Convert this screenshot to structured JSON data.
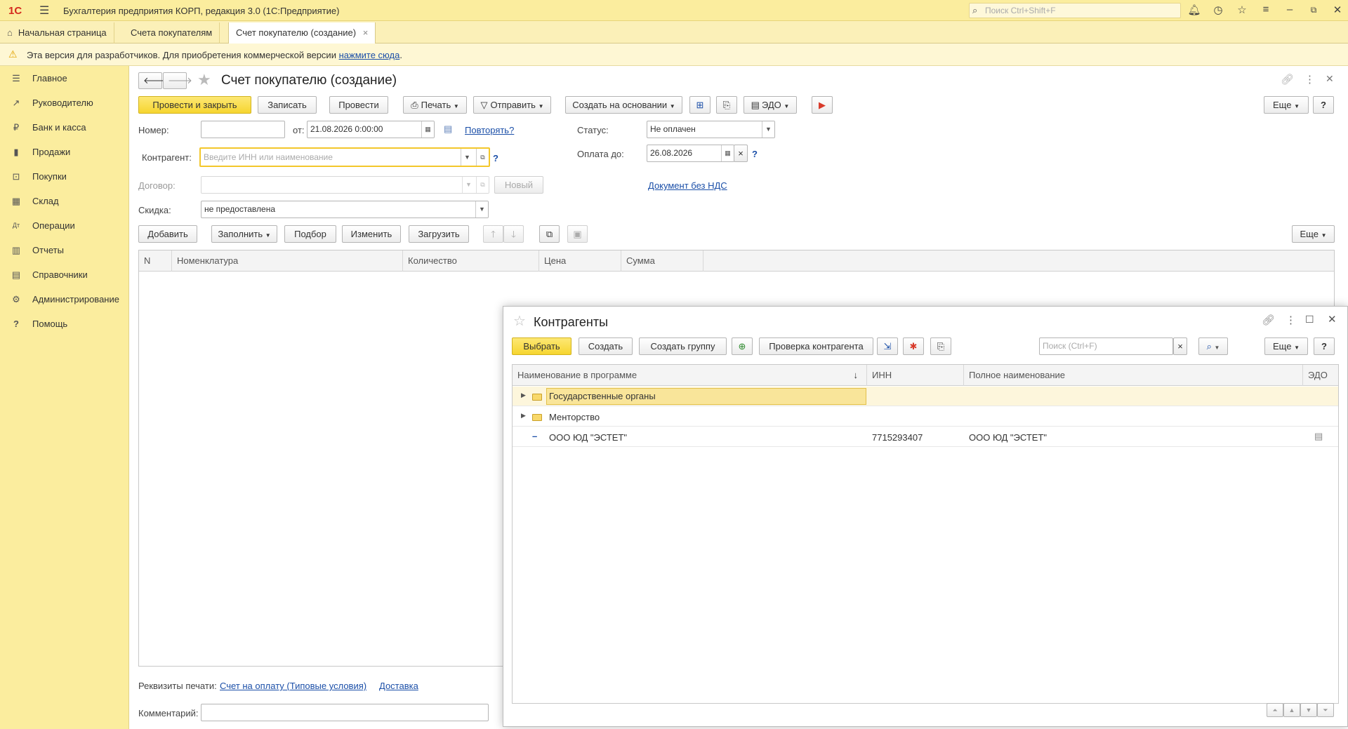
{
  "titlebar": {
    "logo": "1С",
    "app_title": "Бухгалтерия предприятия КОРП, редакция 3.0  (1С:Предприятие)",
    "search_placeholder": "Поиск Ctrl+Shift+F"
  },
  "tabs": {
    "home": "Начальная страница",
    "tab1": "Счета покупателям",
    "tab2": "Счет покупателю (создание)",
    "close": "×"
  },
  "devbar": {
    "text": "Эта версия для разработчиков. Для приобретения коммерческой версии",
    "link": "нажмите сюда",
    "tail": "."
  },
  "sidebar": {
    "items": [
      {
        "label": "Главное",
        "icon": "☰"
      },
      {
        "label": "Руководителю",
        "icon": "↗"
      },
      {
        "label": "Банк и касса",
        "icon": "₽"
      },
      {
        "label": "Продажи",
        "icon": "▮"
      },
      {
        "label": "Покупки",
        "icon": "⊡"
      },
      {
        "label": "Склад",
        "icon": "▦"
      },
      {
        "label": "Операции",
        "icon": "Дт"
      },
      {
        "label": "Отчеты",
        "icon": "▥"
      },
      {
        "label": "Справочники",
        "icon": "▤"
      },
      {
        "label": "Администрирование",
        "icon": "⚙"
      },
      {
        "label": "Помощь",
        "icon": "?"
      }
    ]
  },
  "doc": {
    "title": "Счет покупателю (создание)",
    "toolbar": {
      "post_close": "Провести и закрыть",
      "save": "Записать",
      "post": "Провести",
      "print": "Печать",
      "send": "Отправить",
      "create_based": "Создать на основании",
      "edo": "ЭДО",
      "more": "Еще",
      "help": "?"
    },
    "number_label": "Номер:",
    "number_value": "",
    "from_label": "от:",
    "date_value": "21.08.2026  0:00:00",
    "repeat_link": "Повторять?",
    "status_label": "Статус:",
    "status_value": "Не оплачен",
    "counterparty_label": "Контрагент:",
    "counterparty_placeholder": "Введите ИНН или наименование",
    "pay_until_label": "Оплата до:",
    "pay_until_value": "26.08.2026",
    "contract_label": "Договор:",
    "new_button": "Новый",
    "no_vat_link": "Документ без НДС",
    "discount_label": "Скидка:",
    "discount_value": "не предоставлена",
    "table_toolbar": {
      "add": "Добавить",
      "fill": "Заполнить",
      "pick": "Подбор",
      "edit": "Изменить",
      "load": "Загрузить",
      "more": "Еще"
    },
    "columns": [
      "N",
      "Номенклатура",
      "Количество",
      "Цена",
      "Сумма"
    ],
    "print_requisites_label": "Реквизиты печати:",
    "print_link1": "Счет на оплату (Типовые условия)",
    "print_link2": "Доставка",
    "comment_label": "Комментарий:",
    "comment_value": ""
  },
  "modal": {
    "title": "Контрагенты",
    "toolbar": {
      "select": "Выбрать",
      "create": "Создать",
      "create_group": "Создать группу",
      "check": "Проверка контрагента",
      "search_placeholder": "Поиск (Ctrl+F)",
      "more": "Еще",
      "help": "?"
    },
    "columns": [
      "Наименование в программе",
      "ИНН",
      "Полное наименование",
      "ЭДО"
    ],
    "sort_indicator": "↓",
    "rows": [
      {
        "name": "Государственные органы",
        "inn": "",
        "full": "",
        "type": "folder"
      },
      {
        "name": "Менторство",
        "inn": "",
        "full": "",
        "type": "folder"
      },
      {
        "name": "ООО ЮД \"ЭСТЕТ\"",
        "inn": "7715293407",
        "full": "ООО ЮД \"ЭСТЕТ\"",
        "type": "item"
      }
    ]
  },
  "colors": {
    "accent_yellow": "#f6d52f",
    "sidebar_bg": "#fbed9e",
    "link_blue": "#1b4fa8"
  }
}
